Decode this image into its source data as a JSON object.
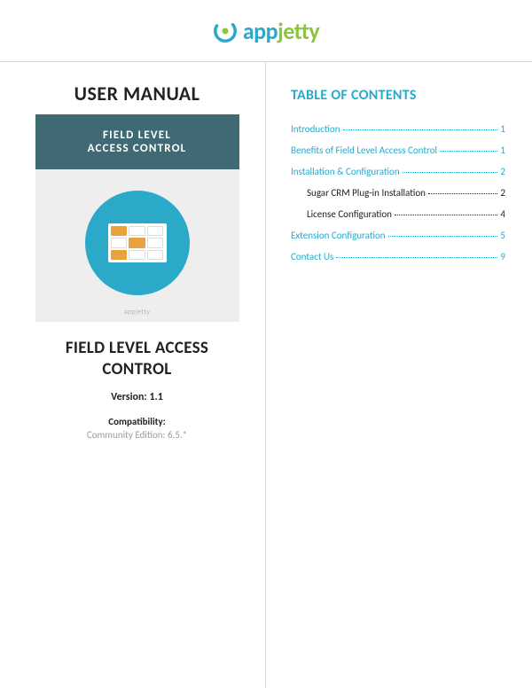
{
  "logo": {
    "part1": "app",
    "part2": "jetty"
  },
  "left": {
    "heading": "USER MANUAL",
    "cover": {
      "line1": "FIELD LEVEL",
      "line2": "ACCESS CONTROL",
      "footer": "appjetty"
    },
    "title": "FIELD LEVEL ACCESS CONTROL",
    "version": "Version: 1.1",
    "compat_label": "Compatibility:",
    "compat_value": "Community Edition: 6.5.*"
  },
  "toc": {
    "title": "TABLE OF CONTENTS",
    "items": [
      {
        "label": "Introduction",
        "page": "1",
        "link": true,
        "sub": false
      },
      {
        "label": "Benefits of Field Level Access Control",
        "page": "1",
        "link": true,
        "sub": false
      },
      {
        "label": "Installation & Configuration",
        "page": "2",
        "link": true,
        "sub": false
      },
      {
        "label": "Sugar CRM Plug-in Installation",
        "page": "2",
        "link": false,
        "sub": true
      },
      {
        "label": "License Configuration",
        "page": "4",
        "link": false,
        "sub": true
      },
      {
        "label": "Extension Configuration",
        "page": "5",
        "link": true,
        "sub": false
      },
      {
        "label": "Contact Us",
        "page": "9",
        "link": true,
        "sub": false
      }
    ]
  }
}
